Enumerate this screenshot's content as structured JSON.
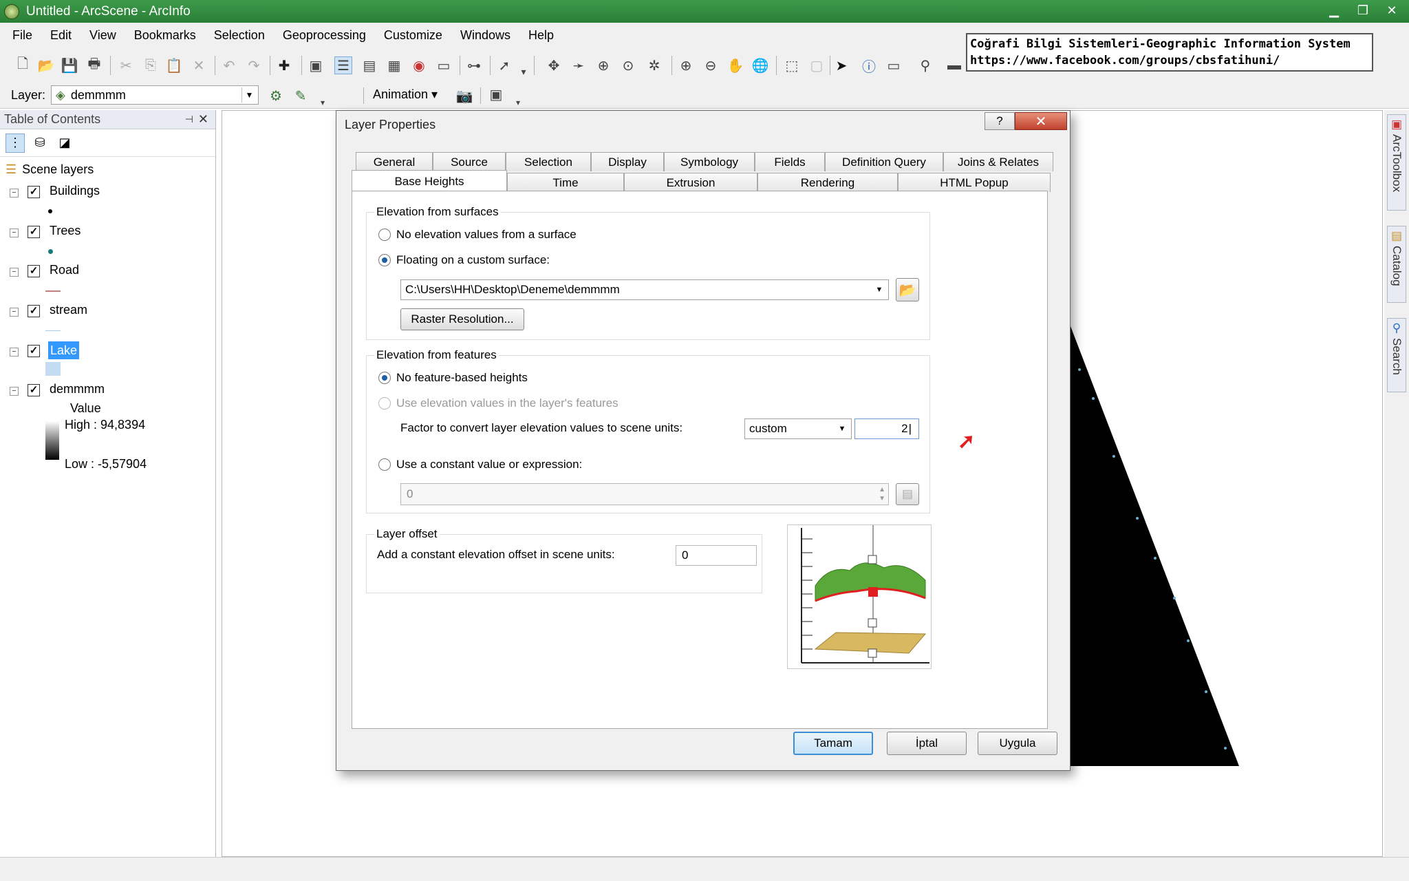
{
  "window": {
    "title": "Untitled - ArcScene - ArcInfo"
  },
  "menu": [
    "File",
    "Edit",
    "View",
    "Bookmarks",
    "Selection",
    "Geoprocessing",
    "Customize",
    "Windows",
    "Help"
  ],
  "note": {
    "line1": "Coğrafi Bilgi Sistemleri-Geographic Information System",
    "line2": "https://www.facebook.com/groups/cbsfatihuni/"
  },
  "toolbar2": {
    "layer_label": "Layer:",
    "layer_value": "demmmm",
    "animation_label": "Animation ▾"
  },
  "toc": {
    "title": "Table of Contents",
    "root": "Scene layers",
    "layers": [
      {
        "name": "Buildings",
        "checked": true
      },
      {
        "name": "Trees",
        "checked": true
      },
      {
        "name": "Road",
        "checked": true
      },
      {
        "name": "stream",
        "checked": true
      },
      {
        "name": "Lake",
        "checked": true
      },
      {
        "name": "demmmm",
        "checked": true
      }
    ],
    "legend": {
      "field": "Value",
      "high": "High : 94,8394",
      "low": "Low : -5,57904"
    }
  },
  "dock": {
    "tab1": "ArcToolbox",
    "tab2": "Catalog",
    "tab3": "Search"
  },
  "dialog": {
    "title": "Layer Properties",
    "help": "?",
    "close": "✕",
    "tabs_row1": [
      "General",
      "Source",
      "Selection",
      "Display",
      "Symbology",
      "Fields",
      "Definition Query",
      "Joins & Relates"
    ],
    "tabs_row2": [
      "Base Heights",
      "Time",
      "Extrusion",
      "Rendering",
      "HTML Popup"
    ],
    "active_tab": "Base Heights",
    "surfaces": {
      "group": "Elevation from surfaces",
      "opt_none": "No elevation values from a surface",
      "opt_custom": "Floating on a custom surface:",
      "surface_path": "C:\\Users\\HH\\Desktop\\Deneme\\demmmm",
      "raster_btn": "Raster Resolution..."
    },
    "features": {
      "group": "Elevation from features",
      "opt_none": "No feature-based heights",
      "opt_use": "Use elevation values in the layer's features",
      "factor_label": "Factor to convert layer elevation values to scene units:",
      "factor_unit": "custom",
      "factor_value": "2",
      "opt_constant": "Use a constant value or expression:",
      "constant_value": "0"
    },
    "offset": {
      "group": "Layer offset",
      "label": "Add a constant elevation offset in scene units:",
      "value": "0"
    },
    "buttons": {
      "ok": "Tamam",
      "cancel": "İptal",
      "apply": "Uygula"
    }
  },
  "colors": {
    "titlebar": "#2e8a3c",
    "selection": "#3399ff",
    "accent_arrow": "#e02020"
  }
}
